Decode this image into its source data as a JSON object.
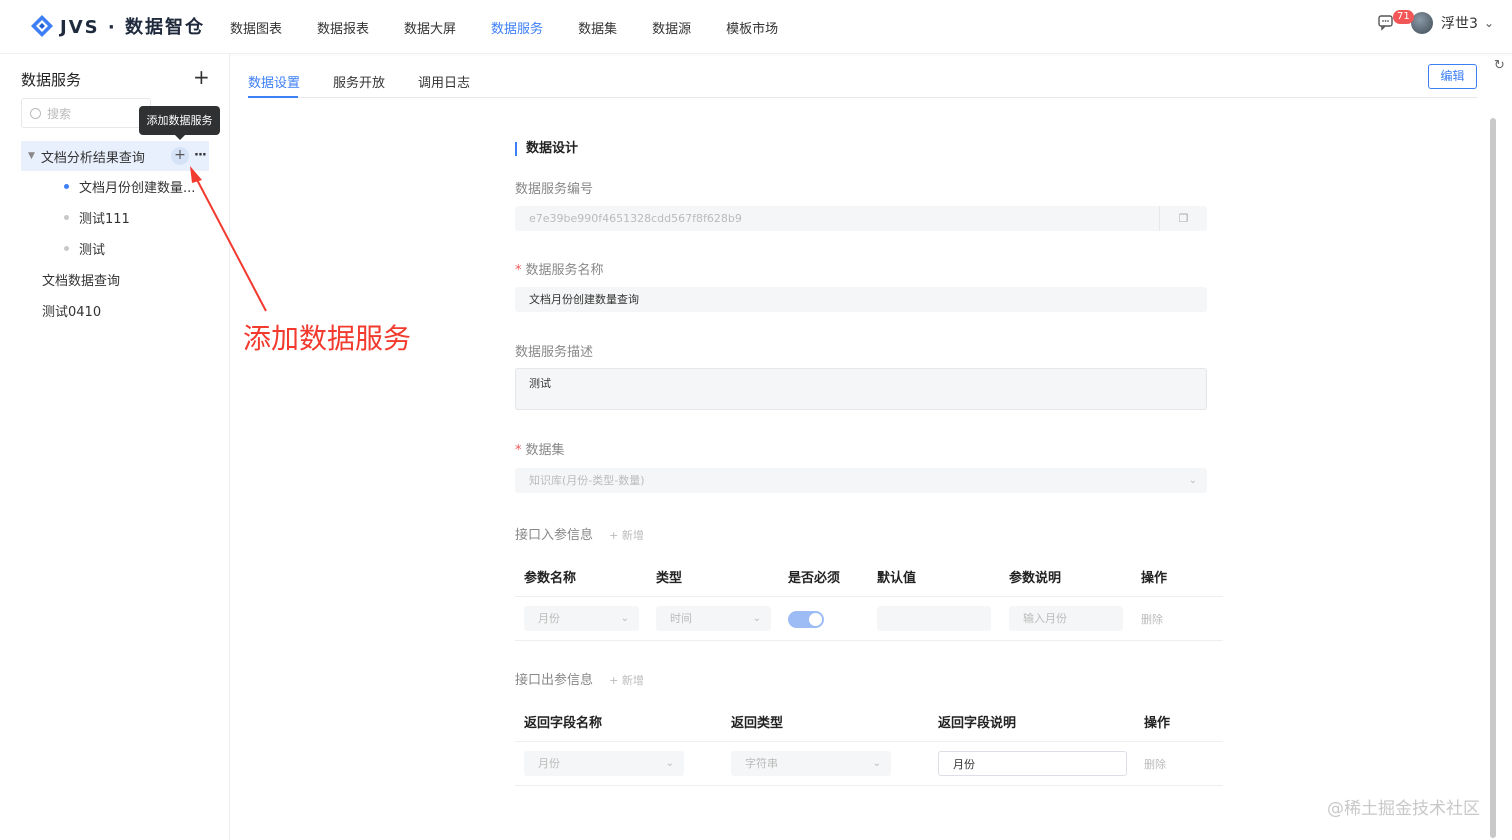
{
  "app": {
    "logo_text": "JVS · 数据智仓"
  },
  "nav": {
    "items": [
      "数据图表",
      "数据报表",
      "数据大屏",
      "数据服务",
      "数据集",
      "数据源",
      "模板市场"
    ],
    "active": "数据服务"
  },
  "user": {
    "badge_count": "71",
    "name": "浮世3"
  },
  "sidebar": {
    "title": "数据服务",
    "search_placeholder": "搜索",
    "tooltip": "添加数据服务",
    "tree": {
      "group": "文档分析结果查询",
      "children": [
        "文档月份创建数量...",
        "测试111",
        "测试"
      ],
      "others": [
        "文档数据查询",
        "测试0410"
      ]
    }
  },
  "annotation": {
    "text": "添加数据服务"
  },
  "tabs": {
    "items": [
      "数据设置",
      "服务开放",
      "调用日志"
    ],
    "active": "数据设置"
  },
  "edit_label": "编辑",
  "form": {
    "section_title": "数据设计",
    "service_id_label": "数据服务编号",
    "service_id_value": "e7e39be990f4651328cdd567f8f628b9",
    "service_name_label": "数据服务名称",
    "service_name_value": "文档月份创建数量查询",
    "service_desc_label": "数据服务描述",
    "service_desc_value": "测试",
    "dataset_label": "数据集",
    "dataset_value": "知识库(月份-类型-数量)",
    "input_params": {
      "title": "接口入参信息",
      "add_label": "+ 新增",
      "headers": [
        "参数名称",
        "类型",
        "是否必须",
        "默认值",
        "参数说明",
        "操作"
      ],
      "row": {
        "name": "月份",
        "type": "时间",
        "required": true,
        "default": "",
        "desc_placeholder": "输入月份",
        "action": "删除"
      }
    },
    "output_params": {
      "title": "接口出参信息",
      "add_label": "+ 新增",
      "headers": [
        "返回字段名称",
        "返回类型",
        "返回字段说明",
        "操作"
      ],
      "row": {
        "name": "月份",
        "type": "字符串",
        "desc": "月份",
        "action": "删除"
      }
    }
  },
  "watermark": "@稀土掘金技术社区",
  "colors": {
    "accent": "#3d7ff6",
    "annotation": "#f23a2e",
    "badge": "#f25656"
  }
}
